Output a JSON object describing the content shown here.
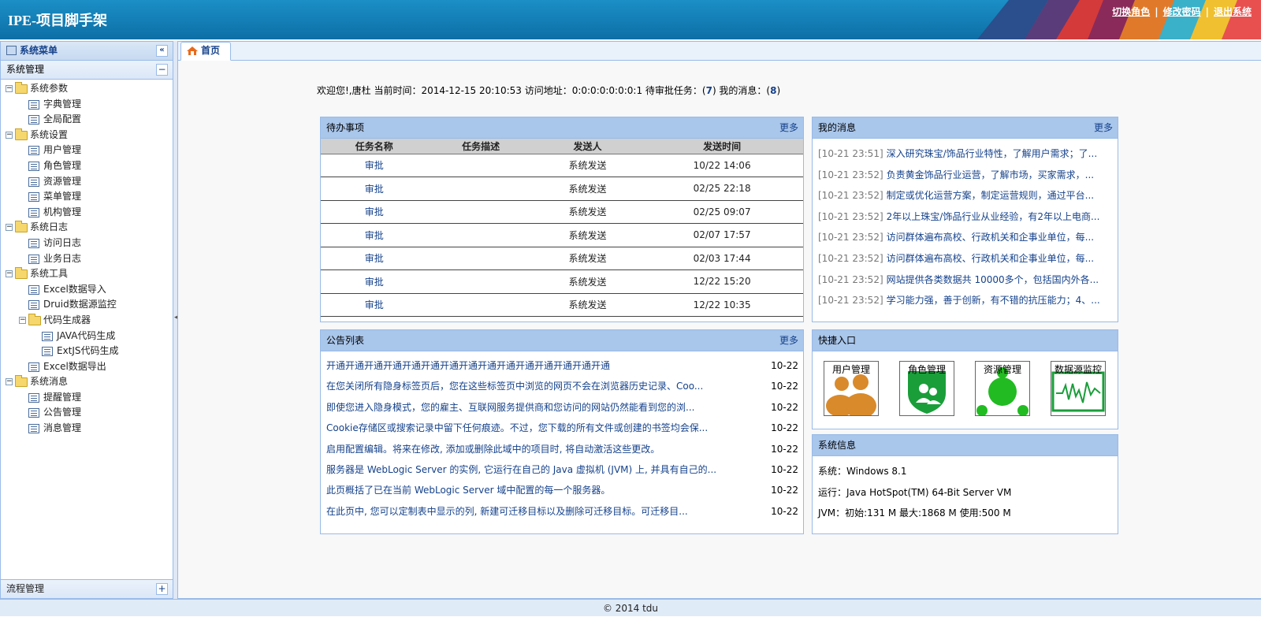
{
  "header": {
    "title": "IPE-项目脚手架",
    "links": [
      "切换角色",
      "修改密码",
      "退出系统"
    ]
  },
  "sidebar": {
    "title": "系统菜单",
    "collapse_glyph": "«",
    "section_title": "系统管理",
    "section_toggle": "−",
    "footer_section": "流程管理",
    "footer_toggle": "+",
    "tree": [
      {
        "label": "系统参数",
        "level": 0,
        "type": "folder"
      },
      {
        "label": "字典管理",
        "level": 1,
        "type": "leaf"
      },
      {
        "label": "全局配置",
        "level": 1,
        "type": "leaf"
      },
      {
        "label": "系统设置",
        "level": 0,
        "type": "folder"
      },
      {
        "label": "用户管理",
        "level": 1,
        "type": "leaf"
      },
      {
        "label": "角色管理",
        "level": 1,
        "type": "leaf"
      },
      {
        "label": "资源管理",
        "level": 1,
        "type": "leaf"
      },
      {
        "label": "菜单管理",
        "level": 1,
        "type": "leaf"
      },
      {
        "label": "机构管理",
        "level": 1,
        "type": "leaf"
      },
      {
        "label": "系统日志",
        "level": 0,
        "type": "folder"
      },
      {
        "label": "访问日志",
        "level": 1,
        "type": "leaf"
      },
      {
        "label": "业务日志",
        "level": 1,
        "type": "leaf"
      },
      {
        "label": "系统工具",
        "level": 0,
        "type": "folder"
      },
      {
        "label": "Excel数据导入",
        "level": 1,
        "type": "leaf"
      },
      {
        "label": "Druid数据源监控",
        "level": 1,
        "type": "leaf"
      },
      {
        "label": "代码生成器",
        "level": 1,
        "type": "folder"
      },
      {
        "label": "JAVA代码生成",
        "level": 2,
        "type": "leaf"
      },
      {
        "label": "ExtJS代码生成",
        "level": 2,
        "type": "leaf"
      },
      {
        "label": "Excel数据导出",
        "level": 1,
        "type": "leaf"
      },
      {
        "label": "系统消息",
        "level": 0,
        "type": "folder"
      },
      {
        "label": "提醒管理",
        "level": 1,
        "type": "leaf"
      },
      {
        "label": "公告管理",
        "level": 1,
        "type": "leaf"
      },
      {
        "label": "消息管理",
        "level": 1,
        "type": "leaf"
      }
    ]
  },
  "tabs": [
    {
      "label": "首页"
    }
  ],
  "welcome": {
    "prefix": "欢迎您!,唐杜 当前时间：2014-12-15 20:10:53 访问地址：0:0:0:0:0:0:0:1 待审批任务：(",
    "pending_count": "7",
    "middle": ") 我的消息：(",
    "message_count": "8",
    "suffix": ")"
  },
  "todo": {
    "title": "待办事项",
    "more": "更多",
    "columns": [
      "任务名称",
      "任务描述",
      "发送人",
      "发送时间"
    ],
    "rows": [
      {
        "name": "审批",
        "desc": "",
        "sender": "系统发送",
        "time": "10/22 14:06"
      },
      {
        "name": "审批",
        "desc": "",
        "sender": "系统发送",
        "time": "02/25 22:18"
      },
      {
        "name": "审批",
        "desc": "",
        "sender": "系统发送",
        "time": "02/25 09:07"
      },
      {
        "name": "审批",
        "desc": "",
        "sender": "系统发送",
        "time": "02/07 17:57"
      },
      {
        "name": "审批",
        "desc": "",
        "sender": "系统发送",
        "time": "02/03 17:44"
      },
      {
        "name": "审批",
        "desc": "",
        "sender": "系统发送",
        "time": "12/22 15:20"
      },
      {
        "name": "审批",
        "desc": "",
        "sender": "系统发送",
        "time": "12/22 10:35"
      }
    ]
  },
  "messages": {
    "title": "我的消息",
    "more": "更多",
    "items": [
      {
        "time": "[10-21 23:51]",
        "text": "深入研究珠宝/饰品行业特性，了解用户需求；了..."
      },
      {
        "time": "[10-21 23:52]",
        "text": "负责黄金饰品行业运营，了解市场，买家需求，..."
      },
      {
        "time": "[10-21 23:52]",
        "text": "制定或优化运营方案，制定运营规则，通过平台..."
      },
      {
        "time": "[10-21 23:52]",
        "text": "2年以上珠宝/饰品行业从业经验，有2年以上电商..."
      },
      {
        "time": "[10-21 23:52]",
        "text": "访问群体遍布高校、行政机关和企事业单位，每..."
      },
      {
        "time": "[10-21 23:52]",
        "text": "访问群体遍布高校、行政机关和企事业单位，每..."
      },
      {
        "time": "[10-21 23:52]",
        "text": "网站提供各类数据共 10000多个，包括国内外各..."
      },
      {
        "time": "[10-21 23:52]",
        "text": "学习能力强，善于创新，有不错的抗压能力；4、..."
      }
    ]
  },
  "notices": {
    "title": "公告列表",
    "more": "更多",
    "items": [
      {
        "text": "开通开通开通开通开通开通开通开通开通开通开通开通开通开通开通",
        "date": "10-22"
      },
      {
        "text": "在您关闭所有隐身标签页后，您在这些标签页中浏览的网页不会在浏览器历史记录、Coo...",
        "date": "10-22"
      },
      {
        "text": "即使您进入隐身模式，您的雇主、互联网服务提供商和您访问的网站仍然能看到您的浏...",
        "date": "10-22"
      },
      {
        "text": "Cookie存储区或搜索记录中留下任何痕迹。不过，您下载的所有文件或创建的书签均会保...",
        "date": "10-22"
      },
      {
        "text": "启用配置编辑。将来在修改, 添加或删除此域中的项目时, 将自动激活这些更改。",
        "date": "10-22"
      },
      {
        "text": "服务器是 WebLogic Server 的实例, 它运行在自己的 Java 虚拟机 (JVM) 上, 并具有自己的...",
        "date": "10-22"
      },
      {
        "text": "此页概括了已在当前 WebLogic Server 域中配置的每一个服务器。",
        "date": "10-22"
      },
      {
        "text": "在此页中, 您可以定制表中显示的列, 新建可迁移目标以及删除可迁移目标。可迁移目...",
        "date": "10-22"
      }
    ]
  },
  "quick": {
    "title": "快捷入口",
    "items": [
      {
        "label": "用户管理",
        "icon": "users-icon",
        "color": "#d98a2b"
      },
      {
        "label": "角色管理",
        "icon": "role-shield-icon",
        "color": "#1a9e3a"
      },
      {
        "label": "资源管理",
        "icon": "resource-network-icon",
        "color": "#22bb22"
      },
      {
        "label": "数据源监控",
        "icon": "monitor-chart-icon",
        "color": "#1a9e3a"
      }
    ]
  },
  "sysinfo": {
    "title": "系统信息",
    "rows": [
      "系统：Windows 8.1",
      "运行：Java HotSpot(TM) 64-Bit Server VM",
      "JVM：初始:131 M 最大:1868 M 使用:500 M"
    ]
  },
  "footer": {
    "text": "© 2014 tdu"
  }
}
